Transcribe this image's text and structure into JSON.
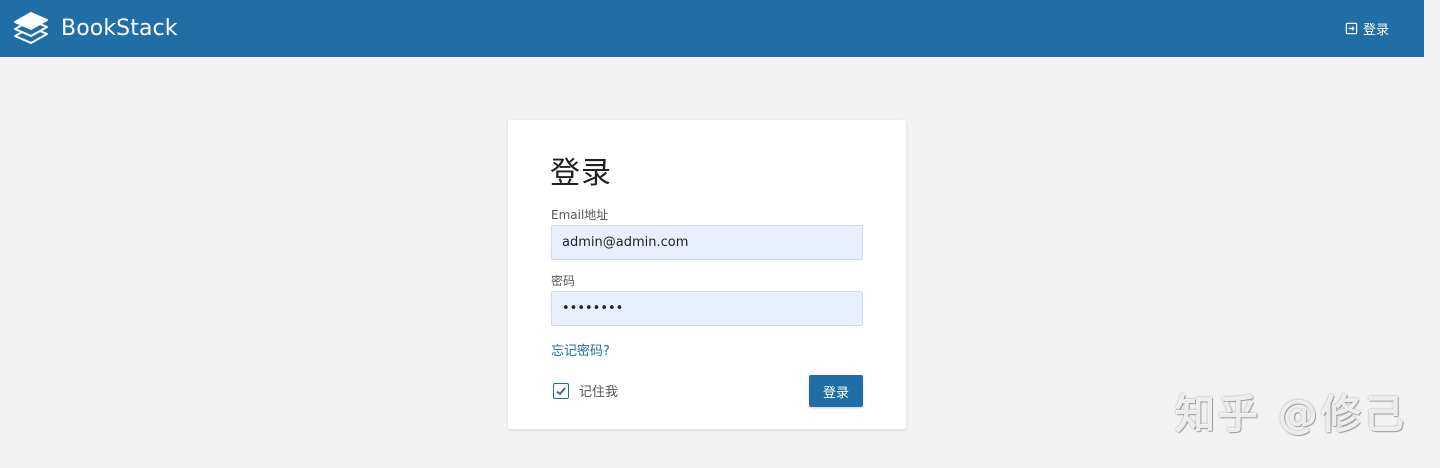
{
  "header": {
    "app_name": "BookStack",
    "logo_icon": "bookstack-logo-icon",
    "login_link": "登录",
    "login_icon": "login-icon",
    "background_color": "#206ea7"
  },
  "login_form": {
    "title": "登录",
    "email_label": "Email地址",
    "email_value": "admin@admin.com",
    "password_label": "密码",
    "password_value": "password",
    "forgot_password_link": "忘记密码?",
    "remember_me_label": "记住我",
    "remember_me_checked": true,
    "submit_label": "登录",
    "accent_color": "#206ea7"
  },
  "watermark": "知乎 @修己"
}
